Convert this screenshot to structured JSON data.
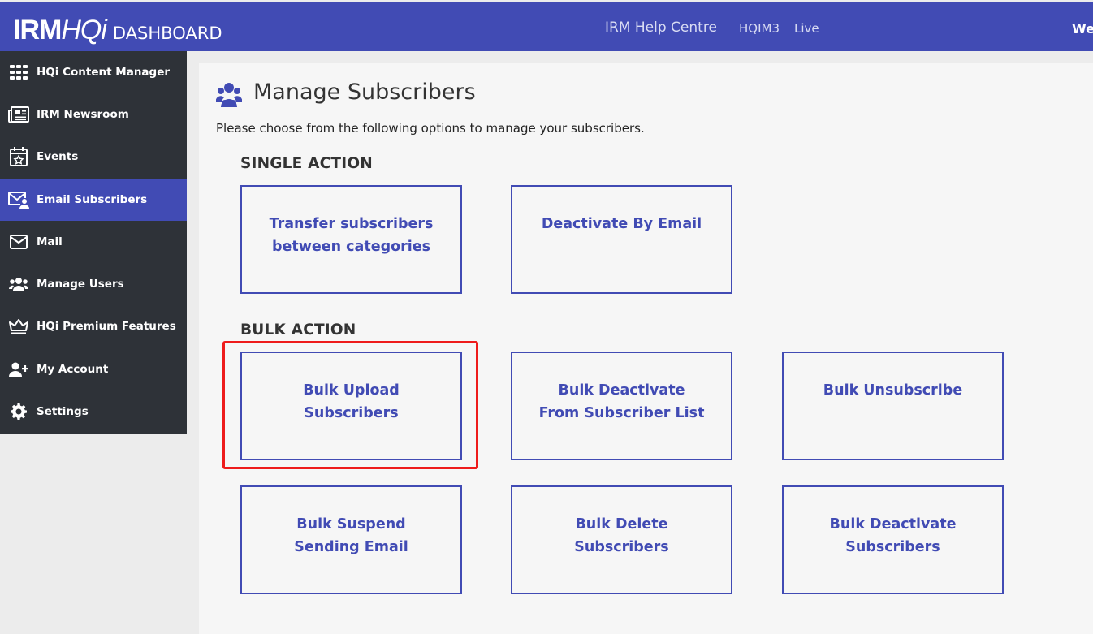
{
  "header": {
    "logo_irm": "IRM",
    "logo_hqi": "HQi",
    "logo_dashboard": "DASHBOARD",
    "help_link": "IRM Help Centre",
    "hqim_label": "HQIM3",
    "live_label": "Live",
    "welcome_fragment": "We",
    "brand_color": "#414bb4"
  },
  "sidebar": {
    "items": [
      {
        "label": "HQi Content Manager",
        "icon": "grid-icon"
      },
      {
        "label": "IRM Newsroom",
        "icon": "newspaper-icon"
      },
      {
        "label": "Events",
        "icon": "calendar-star-icon"
      },
      {
        "label": "Email Subscribers",
        "icon": "envelope-user-icon",
        "active": true
      },
      {
        "label": "Mail",
        "icon": "mail-icon"
      },
      {
        "label": "Manage Users",
        "icon": "users-icon"
      },
      {
        "label": "HQi Premium Features",
        "icon": "crown-icon"
      },
      {
        "label": "My Account",
        "icon": "user-plus-icon"
      },
      {
        "label": "Settings",
        "icon": "gear-icon"
      }
    ]
  },
  "main": {
    "title": "Manage Subscribers",
    "description": "Please choose from the following options to manage your subscribers.",
    "single_action_heading": "SINGLE ACTION",
    "bulk_action_heading": "BULK ACTION",
    "single_cards": [
      "Transfer subscribers\nbetween categories",
      "Deactivate By Email"
    ],
    "bulk_cards": [
      "Bulk Upload\nSubscribers",
      "Bulk Deactivate\nFrom Subscriber List",
      "Bulk Unsubscribe",
      "Bulk Suspend\nSending Email",
      "Bulk Delete\nSubscribers",
      "Bulk Deactivate\nSubscribers"
    ]
  }
}
